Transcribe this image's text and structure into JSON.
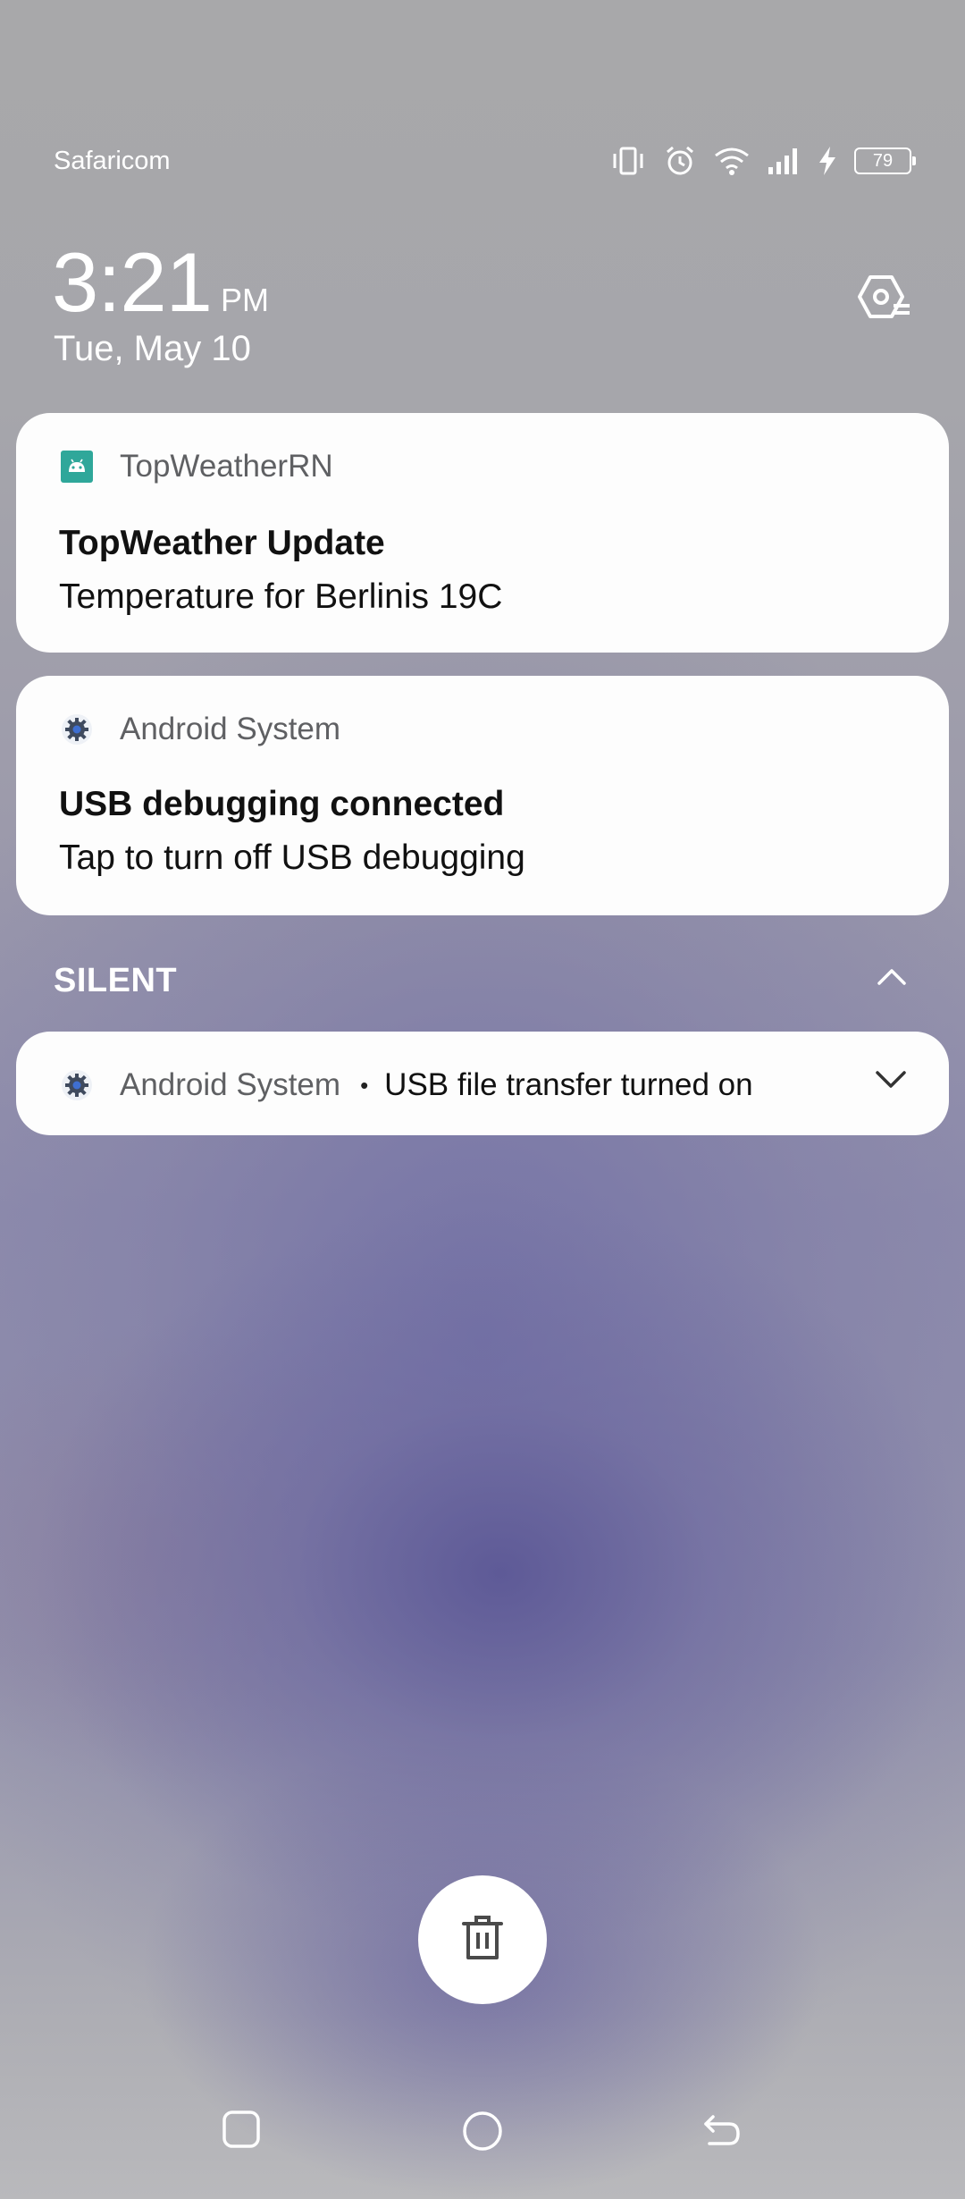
{
  "status_bar": {
    "carrier": "Safaricom",
    "battery_level": "79",
    "icons": [
      "vibrate-icon",
      "alarm-icon",
      "wifi-icon",
      "signal-icon",
      "charging-icon",
      "battery-icon"
    ]
  },
  "lockscreen": {
    "time": "3:21",
    "ampm": "PM",
    "date": "Tue, May 10"
  },
  "notifications": [
    {
      "app": "TopWeatherRN",
      "title": "TopWeather Update",
      "text": "Temperature for Berlinis 19C",
      "icon": "android-app-icon"
    },
    {
      "app": "Android System",
      "title": "USB debugging connected",
      "text": "Tap to turn off USB debugging",
      "icon": "gear-icon"
    }
  ],
  "silent_section": {
    "label": "SILENT",
    "items": [
      {
        "app": "Android System",
        "separator": "•",
        "summary": "USB file transfer turned on",
        "icon": "gear-icon"
      }
    ]
  },
  "colors": {
    "card_background": "#fdfdfd",
    "accent_teal": "#2fa79a",
    "gear_blue": "#3f6fd1"
  }
}
